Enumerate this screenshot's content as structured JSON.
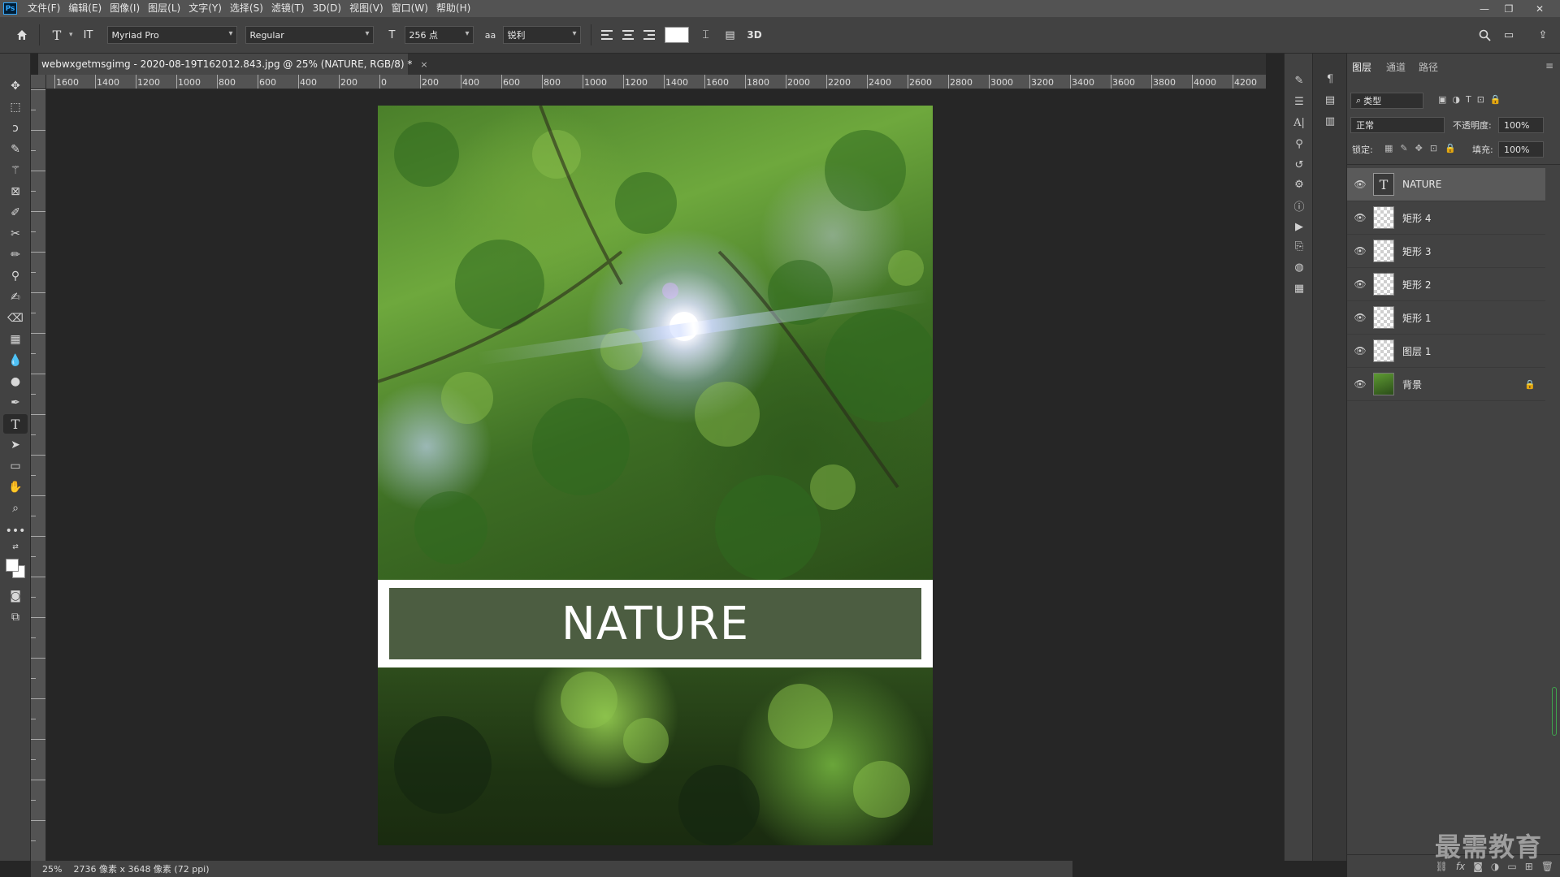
{
  "app": {
    "logo": "Ps"
  },
  "menu": [
    "文件(F)",
    "编辑(E)",
    "图像(I)",
    "图层(L)",
    "文字(Y)",
    "选择(S)",
    "滤镜(T)",
    "3D(D)",
    "视图(V)",
    "窗口(W)",
    "帮助(H)"
  ],
  "window_controls": [
    "—",
    "❐",
    "✕"
  ],
  "options": {
    "tool_icon": "T",
    "orient_icon": "IT",
    "font_family": "Myriad Pro",
    "font_style": "Regular",
    "font_size": "256 点",
    "aa_icon": "aa",
    "anti_alias": "锐利",
    "text_color": "#ffffff",
    "btn_3d": "3D"
  },
  "document": {
    "tab_title": "webwxgetmsgimg - 2020-08-19T162012.843.jpg @ 25% (NATURE, RGB/8) *",
    "close": "×",
    "banner_text": "NATURE",
    "banner_color": "#4c5d41"
  },
  "ruler": {
    "h_ticks": [
      "1600",
      "1400",
      "1200",
      "1000",
      "800",
      "600",
      "400",
      "200",
      "0",
      "200",
      "400",
      "600",
      "800",
      "1000",
      "1200",
      "1400",
      "1600",
      "1800",
      "2000",
      "2200",
      "2400",
      "2600",
      "2800",
      "3000",
      "3200",
      "3400",
      "3600",
      "3800",
      "4000",
      "4200"
    ]
  },
  "status": {
    "zoom": "25%",
    "info": "2736 像素 x 3648 像素 (72 ppi)"
  },
  "layers_panel": {
    "tabs": [
      "图层",
      "通道",
      "路径"
    ],
    "filter": "类型",
    "blend_mode": "正常",
    "opacity_label": "不透明度:",
    "opacity": "100%",
    "lock_label": "锁定:",
    "fill_label": "填充:",
    "fill": "100%",
    "layers": [
      {
        "name": "NATURE",
        "kind": "text",
        "selected": true
      },
      {
        "name": "矩形 4",
        "kind": "shape"
      },
      {
        "name": "矩形 3",
        "kind": "shape"
      },
      {
        "name": "矩形 2",
        "kind": "shape"
      },
      {
        "name": "矩形 1",
        "kind": "shape"
      },
      {
        "name": "图层 1",
        "kind": "pixel"
      },
      {
        "name": "背景",
        "kind": "photo",
        "locked": true
      }
    ]
  },
  "watermark": "最需教育"
}
